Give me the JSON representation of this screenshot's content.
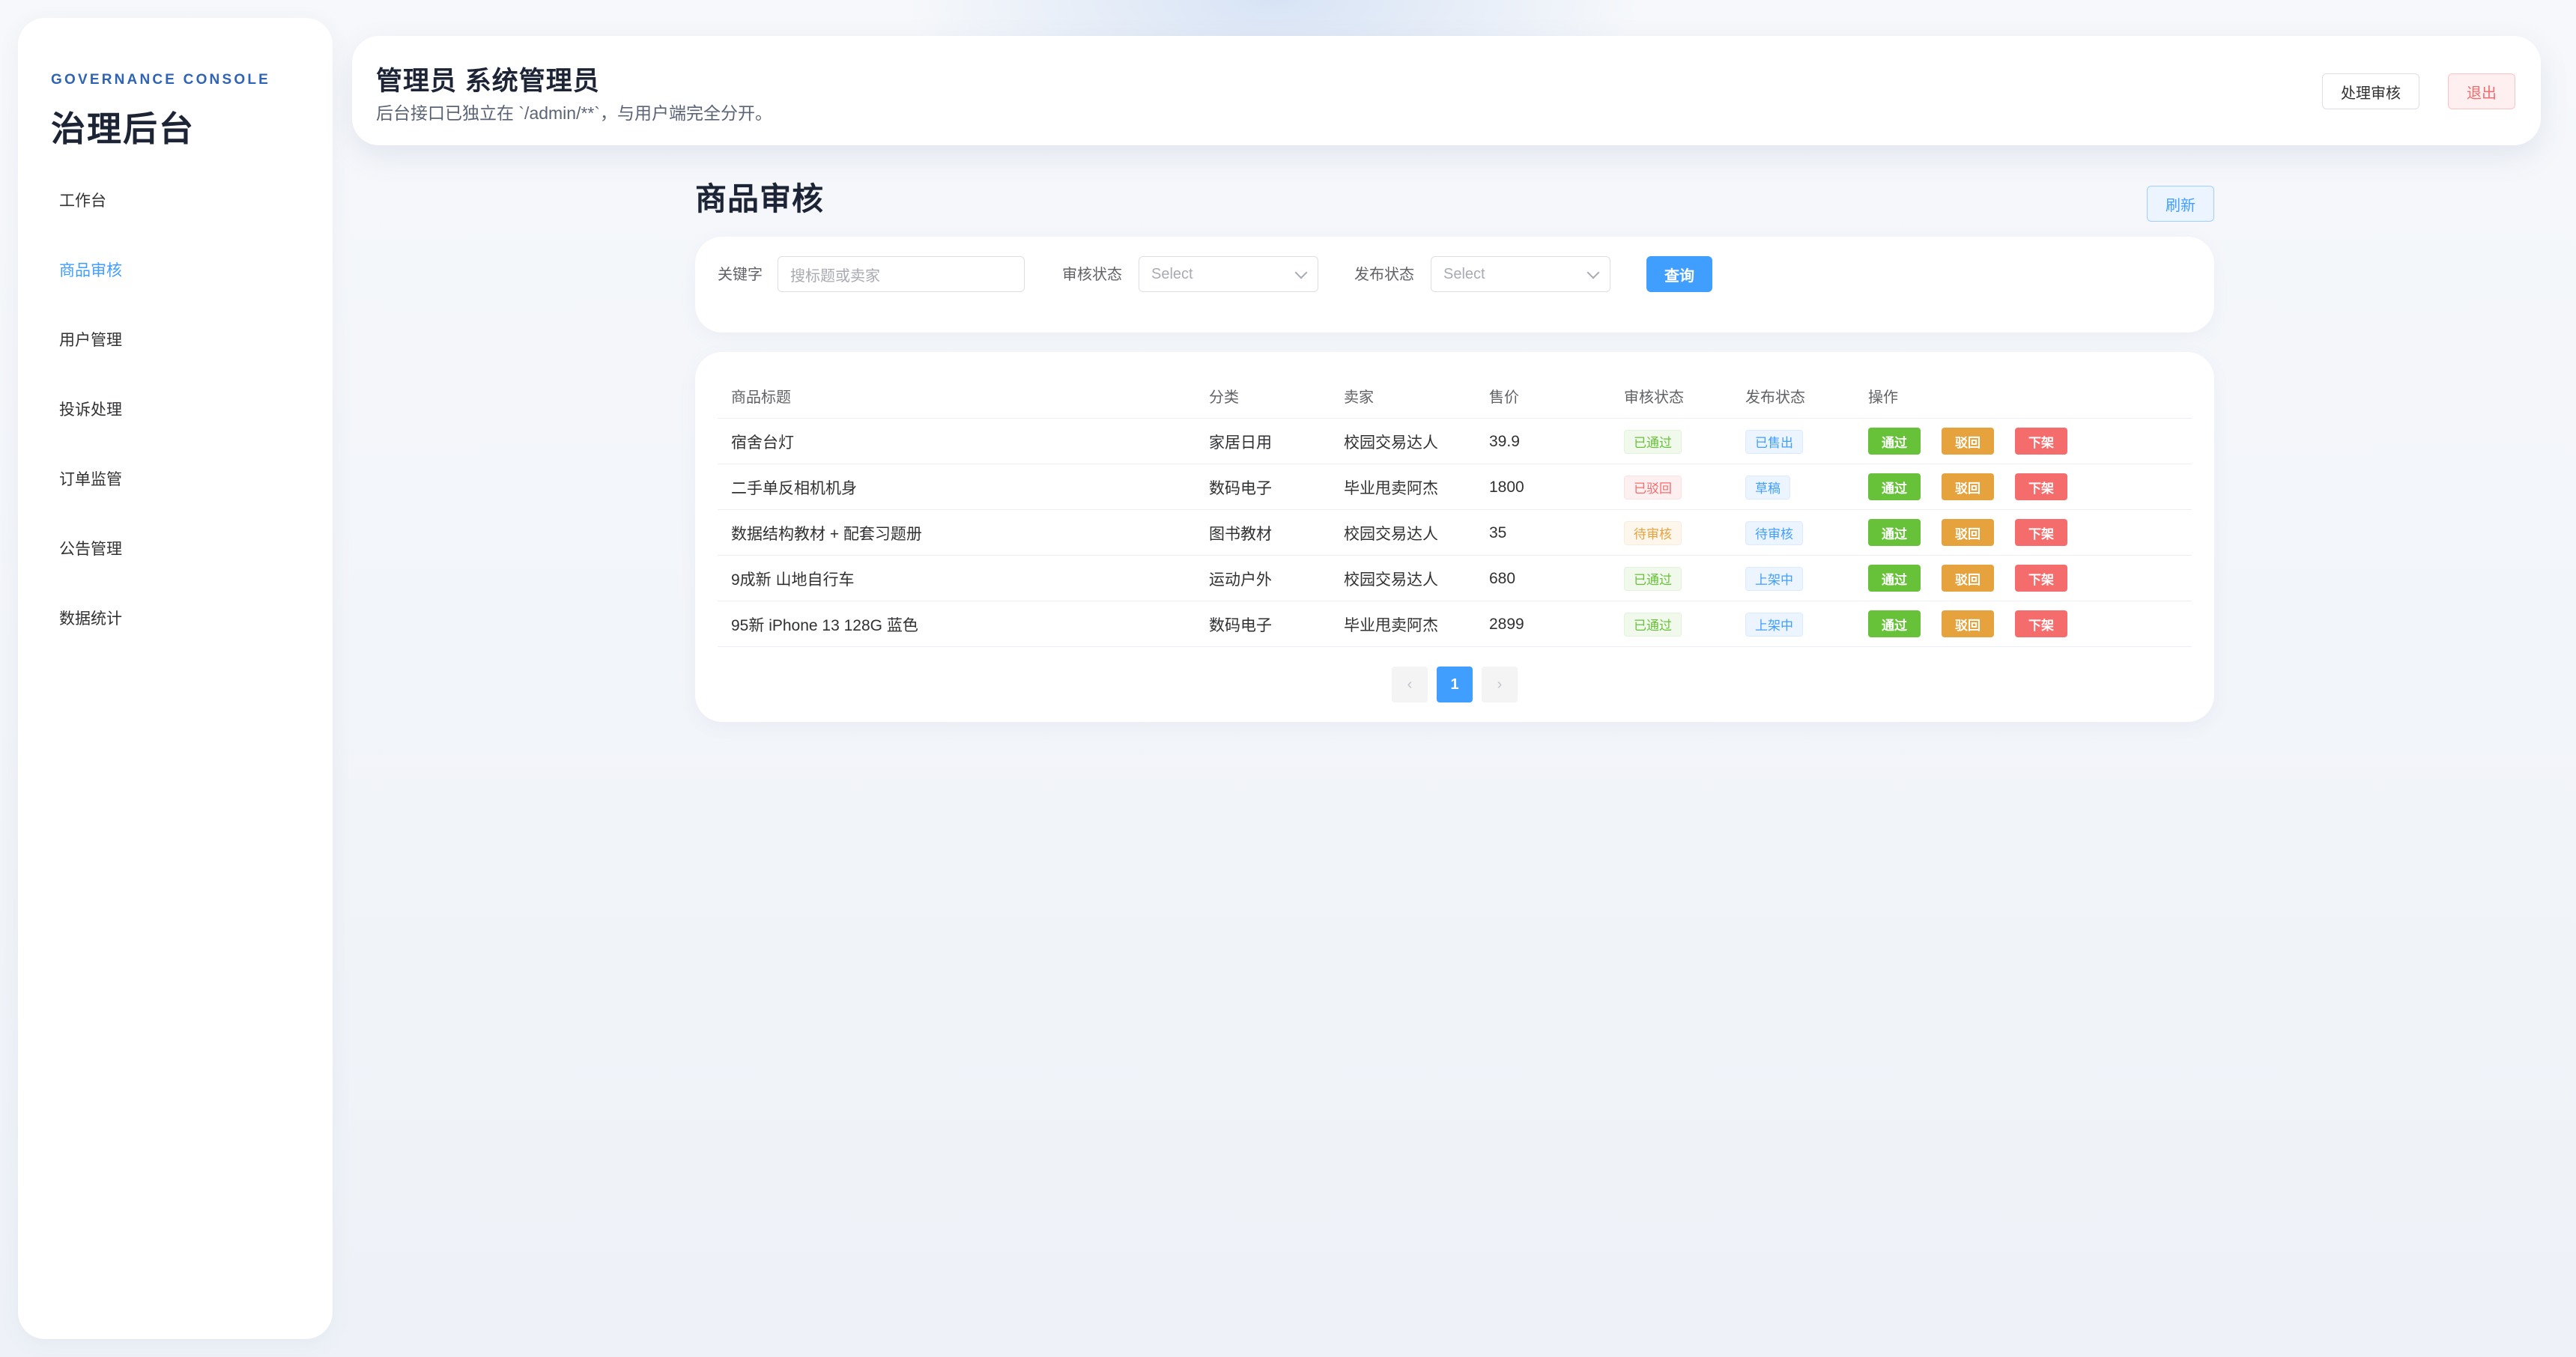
{
  "sidebar": {
    "brand_sub": "GOVERNANCE CONSOLE",
    "brand_title": "治理后台",
    "items": [
      {
        "label": "工作台"
      },
      {
        "label": "商品审核"
      },
      {
        "label": "用户管理"
      },
      {
        "label": "投诉处理"
      },
      {
        "label": "订单监管"
      },
      {
        "label": "公告管理"
      },
      {
        "label": "数据统计"
      }
    ],
    "active_index": 1
  },
  "header": {
    "title": "管理员 系统管理员",
    "description": "后台接口已独立在 `/admin/**`，与用户端完全分开。",
    "process_label": "处理审核",
    "logout_label": "退出"
  },
  "page": {
    "title": "商品审核",
    "refresh_label": "刷新"
  },
  "filters": {
    "keyword_label": "关键字",
    "keyword_placeholder": "搜标题或卖家",
    "review_label": "审核状态",
    "review_placeholder": "Select",
    "publish_label": "发布状态",
    "publish_placeholder": "Select",
    "query_label": "查询"
  },
  "table": {
    "headers": [
      "商品标题",
      "分类",
      "卖家",
      "售价",
      "审核状态",
      "发布状态",
      "操作"
    ],
    "actions": {
      "pass": "通过",
      "reject": "驳回",
      "off": "下架"
    },
    "rows": [
      {
        "title": "宿舍台灯",
        "category": "家居日用",
        "seller": "校园交易达人",
        "price": "39.9",
        "review": "已通过",
        "review_type": "success",
        "publish": "已售出",
        "publish_type": "info"
      },
      {
        "title": "二手单反相机机身",
        "category": "数码电子",
        "seller": "毕业甩卖阿杰",
        "price": "1800",
        "review": "已驳回",
        "review_type": "danger",
        "publish": "草稿",
        "publish_type": "info"
      },
      {
        "title": "数据结构教材 + 配套习题册",
        "category": "图书教材",
        "seller": "校园交易达人",
        "price": "35",
        "review": "待审核",
        "review_type": "warning",
        "publish": "待审核",
        "publish_type": "info"
      },
      {
        "title": "9成新 山地自行车",
        "category": "运动户外",
        "seller": "校园交易达人",
        "price": "680",
        "review": "已通过",
        "review_type": "success",
        "publish": "上架中",
        "publish_type": "info"
      },
      {
        "title": "95新 iPhone 13 128G 蓝色",
        "category": "数码电子",
        "seller": "毕业甩卖阿杰",
        "price": "2899",
        "review": "已通过",
        "review_type": "success",
        "publish": "上架中",
        "publish_type": "info"
      }
    ]
  },
  "pagination": {
    "prev_symbol": "‹",
    "current": "1",
    "next_symbol": "›"
  }
}
